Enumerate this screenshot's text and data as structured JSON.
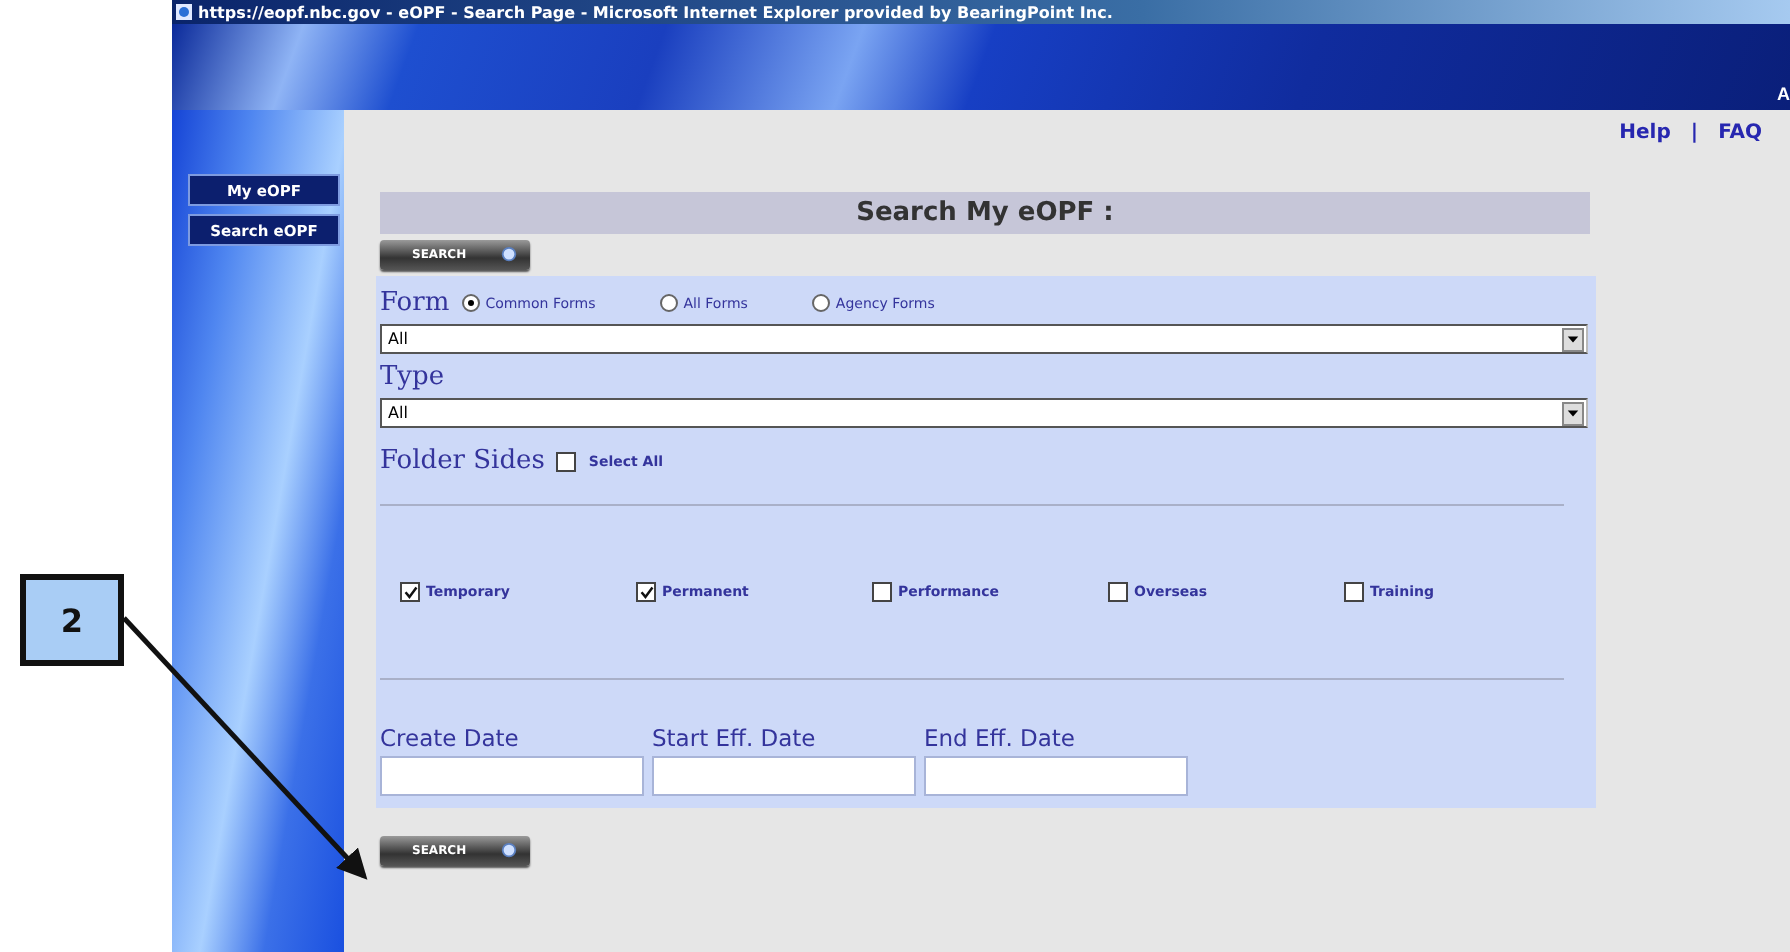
{
  "window": {
    "title": "https://eopf.nbc.gov - eOPF - Search Page - Microsoft Internet Explorer provided by BearingPoint Inc."
  },
  "header": {
    "edge_text": "A"
  },
  "sidebar": {
    "items": [
      {
        "label": "My eOPF"
      },
      {
        "label": "Search eOPF"
      }
    ]
  },
  "top_links": {
    "items": [
      "Help",
      "FAQ"
    ],
    "separator": "|"
  },
  "search": {
    "heading": "Search My eOPF :",
    "top_button": "SEARCH",
    "bottom_button": "SEARCH",
    "form": {
      "label": "Form",
      "options": [
        {
          "label": "Common Forms",
          "selected": true
        },
        {
          "label": "All Forms",
          "selected": false
        },
        {
          "label": "Agency Forms",
          "selected": false
        }
      ],
      "select_value": "All"
    },
    "type": {
      "label": "Type",
      "select_value": "All"
    },
    "folder_sides": {
      "label": "Folder Sides",
      "select_all": {
        "label": "Select All",
        "checked": false
      },
      "sides": [
        {
          "label": "Temporary",
          "checked": true
        },
        {
          "label": "Permanent",
          "checked": true
        },
        {
          "label": "Performance",
          "checked": false
        },
        {
          "label": "Overseas",
          "checked": false
        },
        {
          "label": "Training",
          "checked": false
        }
      ]
    },
    "dates": [
      {
        "label": "Create Date"
      },
      {
        "label": "Start Eff. Date"
      },
      {
        "label": "End Eff. Date"
      }
    ]
  },
  "callout": {
    "number": "2"
  }
}
